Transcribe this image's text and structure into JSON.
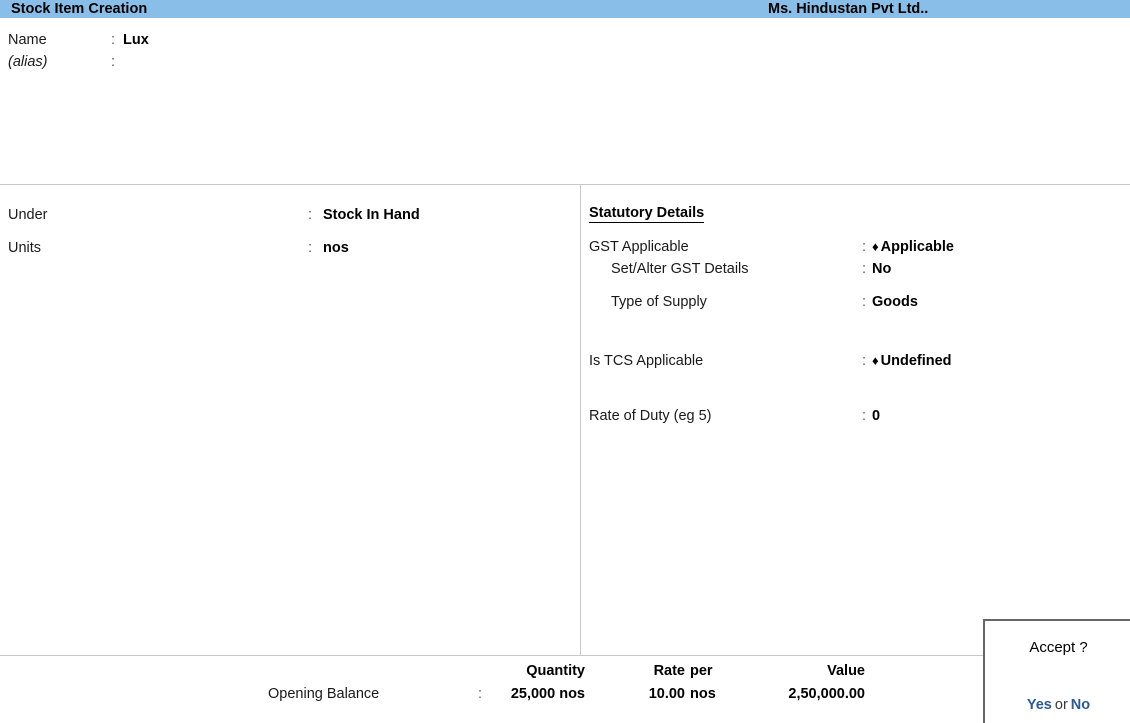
{
  "titlebar": {
    "screen_title": "Stock Item Creation",
    "company_name": "Ms. Hindustan Pvt Ltd..",
    "bg_color": "#88bee8"
  },
  "header": {
    "name_label": "Name",
    "name_value": "Lux",
    "alias_label": "(alias)",
    "alias_value": "",
    "colon": ":"
  },
  "left_panel": {
    "under_label": "Under",
    "under_value": "Stock In Hand",
    "units_label": "Units",
    "units_value": "nos",
    "colon": ":"
  },
  "statutory": {
    "heading": "Statutory Details",
    "colon": ":",
    "diamond": "♦",
    "rows": [
      {
        "label": "GST Applicable",
        "value": "Applicable",
        "has_marker": true
      },
      {
        "label": "Set/Alter GST Details",
        "value": "No",
        "has_marker": false
      },
      {
        "label": "Type of Supply",
        "value": "Goods",
        "has_marker": false
      },
      {
        "label": "Is TCS Applicable",
        "value": "Undefined",
        "has_marker": true
      },
      {
        "label": "Rate of Duty (eg 5)",
        "value": "0",
        "has_marker": false
      }
    ]
  },
  "opening_balance": {
    "row_label": "Opening Balance",
    "colon": ":",
    "columns": [
      "Quantity",
      "Rate",
      "per",
      "Value"
    ],
    "values": [
      "25,000 nos",
      "10.00",
      "nos",
      "2,50,000.00"
    ]
  },
  "accept_dialog": {
    "title": "Accept ?",
    "yes_label": "Yes",
    "or_label": "or",
    "no_label": "No",
    "link_color": "#2a5a9c"
  }
}
